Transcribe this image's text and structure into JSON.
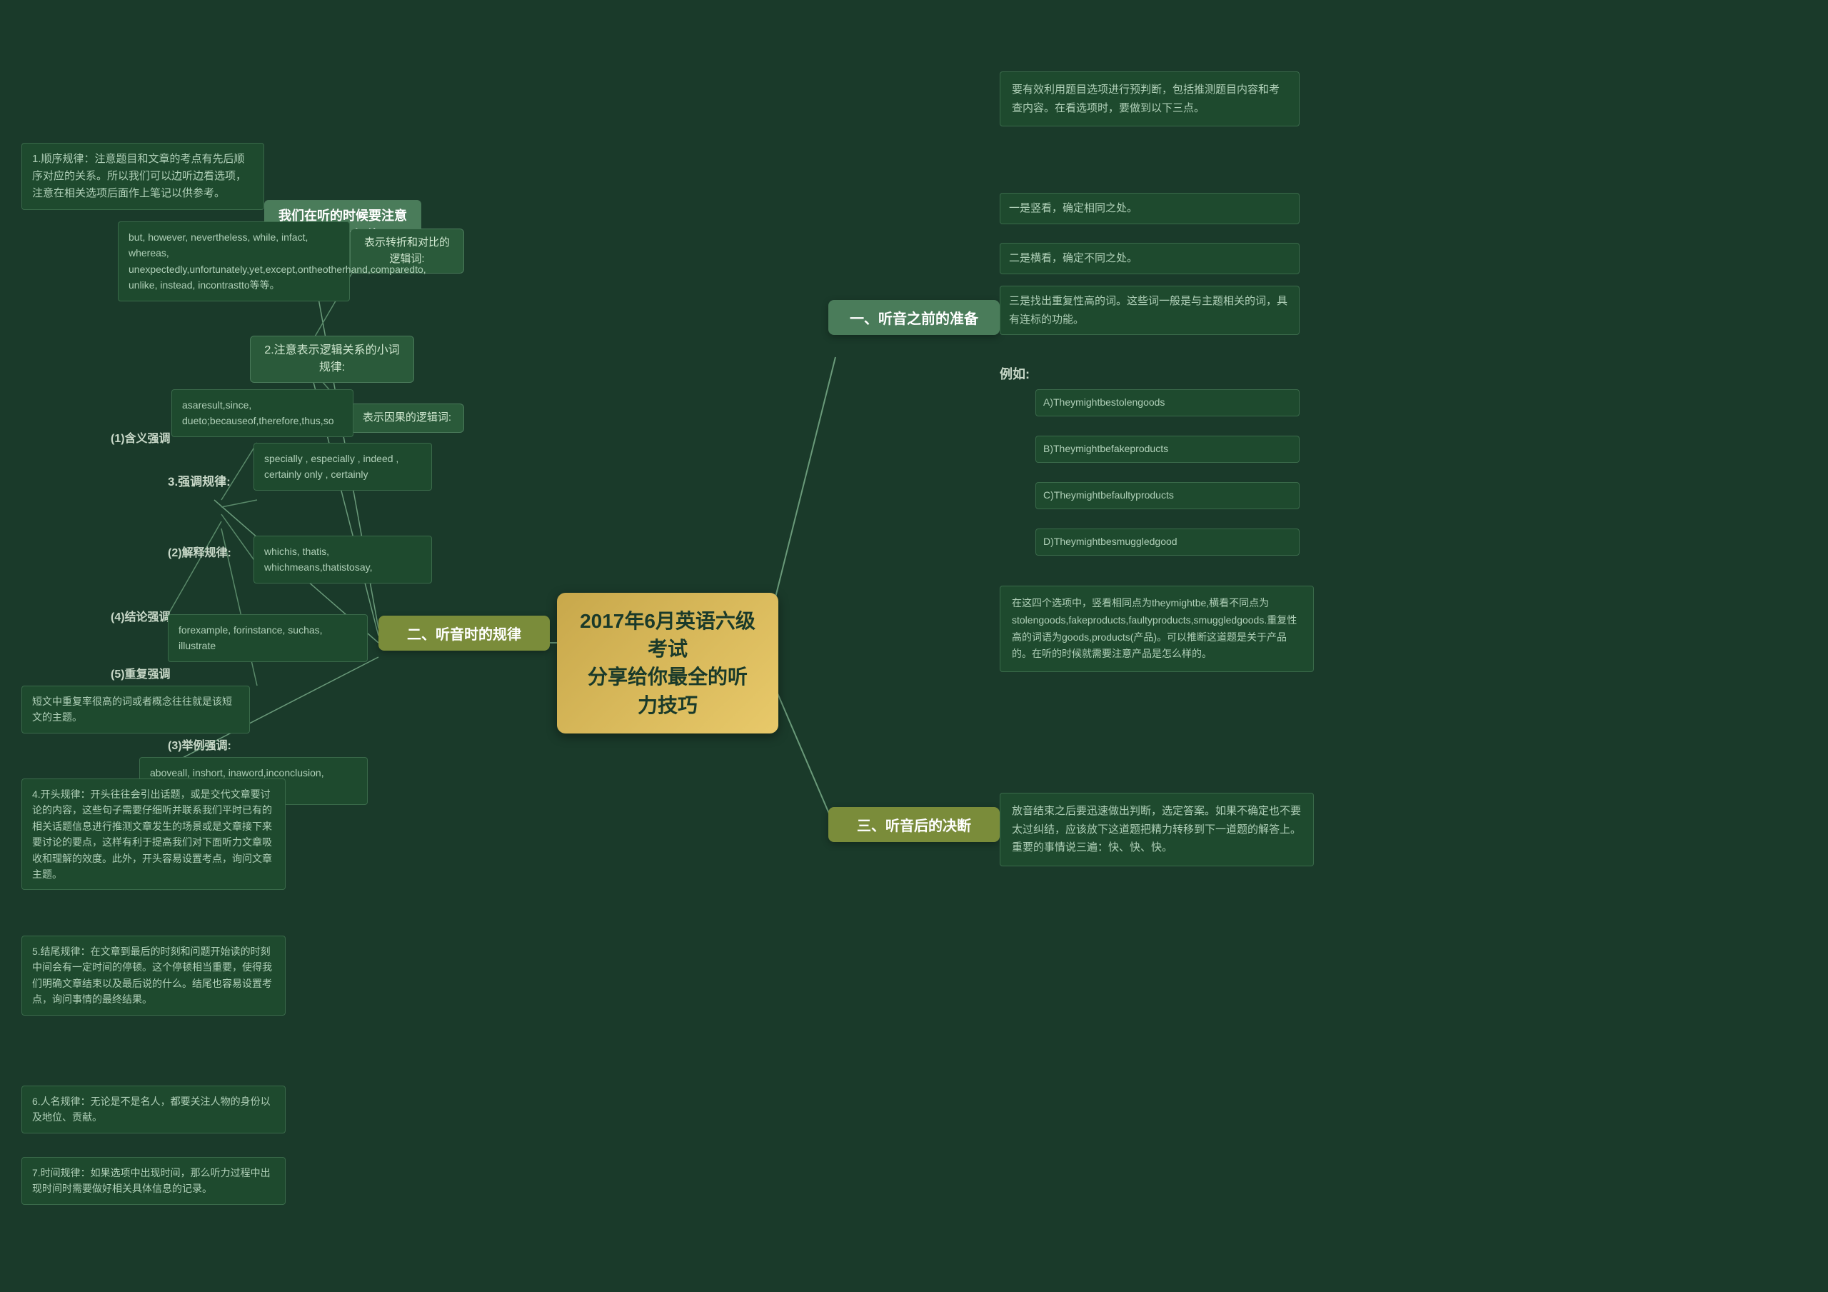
{
  "central": {
    "title_line1": "2017年6月英语六级考试",
    "title_line2": "分享给你最全的听力技巧"
  },
  "branches": {
    "listen_rules": "二、听音时的规律",
    "before_listen": "一、听音之前的准备",
    "after_listen": "三、听音后的决断"
  },
  "left_main": {
    "intro": "我们在听的时候要注意一下几个规律:",
    "rule1_label": "1.顺序规律:",
    "rule1_text": "1.顺序规律：注意题目和文章的考点有先后顺序对应的关系。所以我们可以边听边看选项，注意在相关选项后面作上笔记以供参考。",
    "rule2_label": "2.注意表示逻辑关系的小词规律:",
    "logic_transition_label": "表示转折和对比的逻辑词:",
    "logic_transition_words": "but, however, nevertheless, while, infact, whereas, unexpectedly,unfortunately,yet,except,ontheotherhand,comparedto, unlike, instead, incontrastto等等。",
    "logic_result_label": "表示因果的逻辑词:",
    "logic_result_words": "asaresult,since, dueto;becauseof,therefore,thus,so",
    "emphasize_label": "(1)含义强调",
    "rule3_label": "3.强调规律:",
    "especially_words": "specially , especially , indeed , certainly only , certainly",
    "explain_label": "(2)解释规律:",
    "explain_words": "whichis, thatis, whichmeans,thatistosay,",
    "conclusion_label": "(4)结论强调",
    "conclusion_words": "forexample, forinstance, suchas, illustrate",
    "repeat_label": "(5)重复强调",
    "repeat_text": "短文中重复率很高的词或者概念往往就是该短文的主题。",
    "example_label": "(3)举例强调:",
    "example_words": "aboveall, inshort, inaword,inconclusion, allinall, inbrief",
    "rule4_text": "4.开头规律：开头往往会引出话题，或是交代文章要讨论的内容，这些句子需要仔细听并联系我们平时已有的相关话题信息进行推测文章发生的场景或是文章接下来要讨论的要点，这样有利于提高我们对下面听力文章吸收和理解的效度。此外，开头容易设置考点，询问文章主题。",
    "rule5_text": "5.结尾规律：在文章到最后的时刻和问题开始读的时刻中间会有一定时间的停顿。这个停顿相当重要，使得我们明确文章结束以及最后说的什么。结尾也容易设置考点，询问事情的最终结果。",
    "rule6_text": "6.人名规律：无论是不是名人，都要关注人物的身份以及地位、贡献。",
    "rule7_text": "7.时间规律：如果选项中出现时间，那么听力过程中出现时间时需要做好相关具体信息的记录。"
  },
  "right_before": {
    "intro": "要有效利用题目选项进行预判断，包括推测题目内容和考查内容。在看选项时，要做到以下三点。",
    "point1": "一是竖看，确定相同之处。",
    "point2": "二是横看，确定不同之处。",
    "point3": "三是找出重复性高的词。这些词一般是与主题相关的词，具有连标的功能。",
    "example_label": "例如:",
    "optA": "A)Theymightbestolengoods",
    "optB": "B)Theymightbefakeproducts",
    "optC": "C)Theymightbefaultyproducts",
    "optD": "D)Theymightbesmuggledgood",
    "analysis": "在这四个选项中，竖看相同点为theymightbe,横看不同点为stolengoods,fakeproducts,faultyproducts,smuggledgoods.重复性高的词语为goods,products(产品)。可以推断这道题是关于产品的。在听的时候就需要注意产品是怎么样的。"
  },
  "right_after": {
    "text": "放音结束之后要迅速做出判断，选定答案。如果不确定也不要太过纠结，应该放下这道题把精力转移到下一道题的解答上。重要的事情说三遍：快、快、快。"
  }
}
